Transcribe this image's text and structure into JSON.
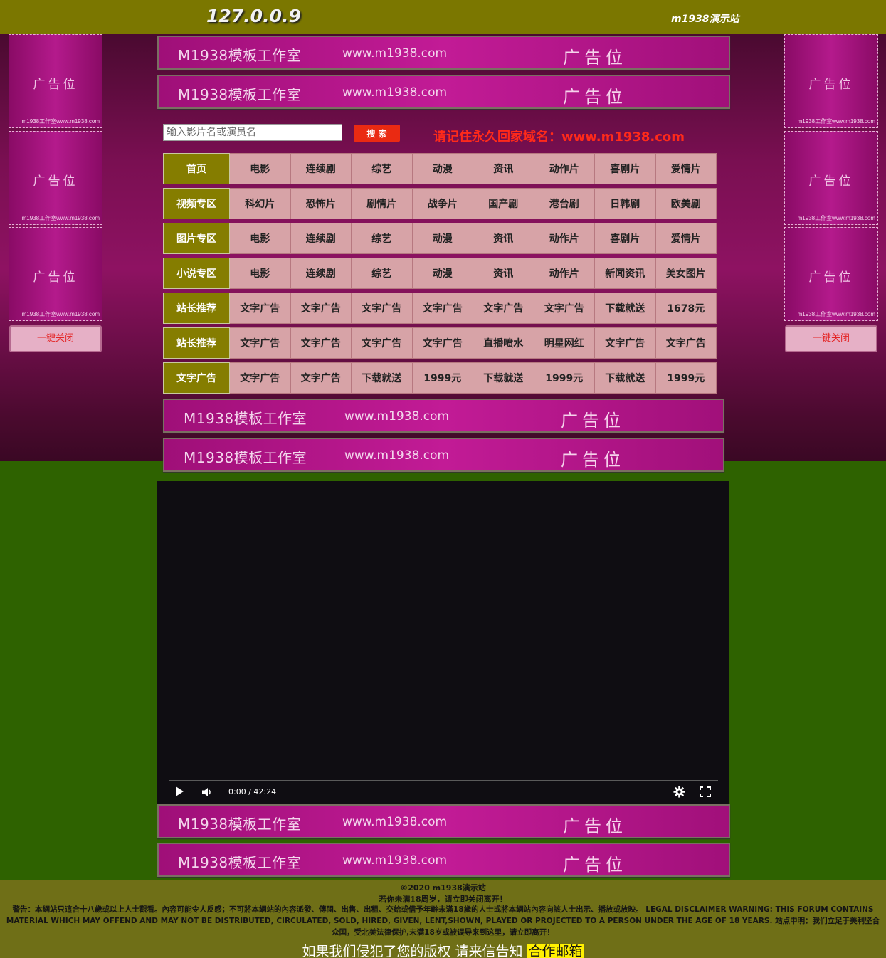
{
  "header": {
    "host": "127.0.0.9",
    "site_name": "m1938演示站"
  },
  "side_ad": {
    "big_text": "广告位",
    "small_text": "m1938工作室www.m1938.com",
    "close_label": "一键关闭"
  },
  "banner": {
    "studio": "M1938模板工作室",
    "url": "www.m1938.com",
    "slot": "广告位"
  },
  "search": {
    "placeholder": "输入影片名或演员名",
    "button_label": "搜 索",
    "remember_text": "请记住永久回家域名：www.m1938.com"
  },
  "nav": {
    "rows": [
      {
        "head": "首页",
        "cells": [
          "电影",
          "连续剧",
          "综艺",
          "动漫",
          "资讯",
          "动作片",
          "喜剧片",
          "爱情片"
        ]
      },
      {
        "head": "视频专区",
        "cells": [
          "科幻片",
          "恐怖片",
          "剧情片",
          "战争片",
          "国产剧",
          "港台剧",
          "日韩剧",
          "欧美剧"
        ]
      },
      {
        "head": "图片专区",
        "cells": [
          "电影",
          "连续剧",
          "综艺",
          "动漫",
          "资讯",
          "动作片",
          "喜剧片",
          "爱情片"
        ]
      },
      {
        "head": "小说专区",
        "cells": [
          "电影",
          "连续剧",
          "综艺",
          "动漫",
          "资讯",
          "动作片",
          "新闻资讯",
          "美女图片"
        ]
      },
      {
        "head": "站长推荐",
        "cells": [
          "文字广告",
          "文字广告",
          "文字广告",
          "文字广告",
          "文字广告",
          "文字广告",
          "下载就送",
          "1678元"
        ]
      },
      {
        "head": "站长推荐",
        "cells": [
          "文字广告",
          "文字广告",
          "文字广告",
          "文字广告",
          "直播喷水",
          "明星网红",
          "文字广告",
          "文字广告"
        ]
      },
      {
        "head": "文字广告",
        "cells": [
          "文字广告",
          "文字广告",
          "下载就送",
          "1999元",
          "下载就送",
          "1999元",
          "下载就送",
          "1999元"
        ]
      }
    ]
  },
  "video": {
    "time": "0:00 / 42:24",
    "progress": 0
  },
  "footer": {
    "copyright": "©2020 m1938演示站",
    "age_notice": "若你未满18周岁，请立即关闭离开！",
    "disclaimer": "警告：本網站只這合十八歲或以上人士觀看。內容可能令人反感；不可將本網站的內容派發、傳閱、出售、出租、交給或借予年齡未滿18歲的人士或將本網站內容向該人士出示、播放或放映。 LEGAL DISCLAIMER WARNING: THIS FORUM CONTAINS MATERIAL WHICH MAY OFFEND AND MAY NOT BE DISTRIBUTED, CIRCULATED, SOLD, HIRED, GIVEN, LENT,SHOWN, PLAYED OR PROJECTED TO A PERSON UNDER THE AGE OF 18 YEARS. 站点申明：我们立足于美利坚合众国，受北美法律保护,未满18岁或被误导来到这里，请立即离开！",
    "copyright_notice": "如果我们侵犯了您的版权 请来信告知",
    "mail_label": "合作邮箱"
  }
}
